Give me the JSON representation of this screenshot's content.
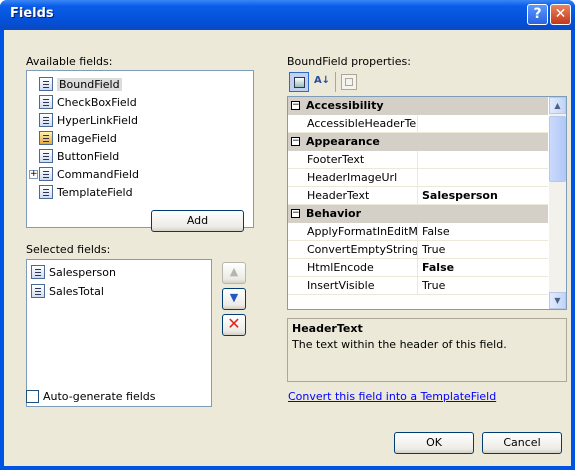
{
  "window": {
    "title": "Fields",
    "help_glyph": "?",
    "close_glyph": "✕"
  },
  "available": {
    "label": "Available fields:",
    "items": [
      {
        "label": "BoundField",
        "icon": "boundfield-icon"
      },
      {
        "label": "CheckBoxField",
        "icon": "checkbox-field-icon"
      },
      {
        "label": "HyperLinkField",
        "icon": "hyperlink-field-icon"
      },
      {
        "label": "ImageField",
        "icon": "image-field-icon"
      },
      {
        "label": "ButtonField",
        "icon": "button-field-icon"
      },
      {
        "label": "CommandField",
        "icon": "command-field-icon"
      },
      {
        "label": "TemplateField",
        "icon": "template-field-icon"
      }
    ],
    "add_label": "Add"
  },
  "selected": {
    "label": "Selected fields:",
    "items": [
      {
        "label": "Salesperson"
      },
      {
        "label": "SalesTotal"
      }
    ]
  },
  "autogen": {
    "label": "Auto-generate fields",
    "checked": false
  },
  "props": {
    "label": "BoundField properties:",
    "rows": [
      {
        "type": "cat",
        "name": "Accessibility"
      },
      {
        "type": "prop",
        "name": "AccessibleHeaderTe",
        "value": ""
      },
      {
        "type": "cat",
        "name": "Appearance"
      },
      {
        "type": "prop",
        "name": "FooterText",
        "value": ""
      },
      {
        "type": "prop",
        "name": "HeaderImageUrl",
        "value": ""
      },
      {
        "type": "prop",
        "name": "HeaderText",
        "value": "Salesperson",
        "bold": true
      },
      {
        "type": "cat",
        "name": "Behavior"
      },
      {
        "type": "prop",
        "name": "ApplyFormatInEditM",
        "value": "False"
      },
      {
        "type": "prop",
        "name": "ConvertEmptyString",
        "value": "True"
      },
      {
        "type": "prop",
        "name": "HtmlEncode",
        "value": "False",
        "bold": true
      },
      {
        "type": "prop",
        "name": "InsertVisible",
        "value": "True"
      }
    ],
    "desc_title": "HeaderText",
    "desc_text": "The text within the header of this field."
  },
  "convert_link": "Convert this field into a TemplateField",
  "ok_label": "OK",
  "cancel_label": "Cancel"
}
